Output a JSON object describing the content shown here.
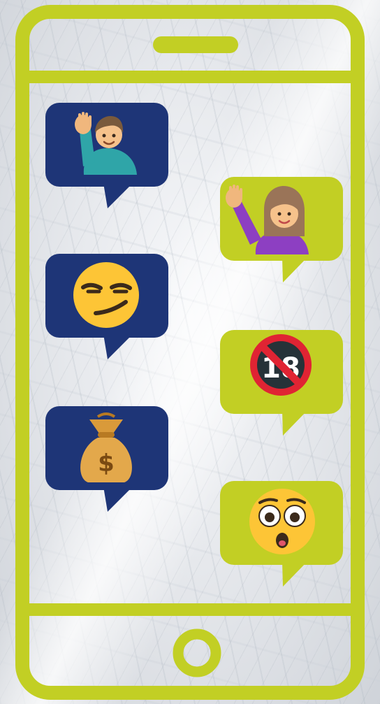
{
  "colors": {
    "frame": "#c2cf24",
    "bubble_navy": "#1e3577",
    "bubble_lime": "#c2cf24"
  },
  "messages": [
    {
      "side": "left",
      "bubble_color": "navy",
      "icon": "man-raising-hand-icon"
    },
    {
      "side": "right",
      "bubble_color": "lime",
      "icon": "woman-raising-hand-icon"
    },
    {
      "side": "left",
      "bubble_color": "navy",
      "icon": "smirking-face-icon"
    },
    {
      "side": "right",
      "bubble_color": "lime",
      "icon": "no-one-under-eighteen-icon"
    },
    {
      "side": "left",
      "bubble_color": "navy",
      "icon": "money-bag-icon"
    },
    {
      "side": "right",
      "bubble_color": "lime",
      "icon": "flushed-face-icon"
    }
  ],
  "badge_text": "18",
  "money_symbol": "$"
}
